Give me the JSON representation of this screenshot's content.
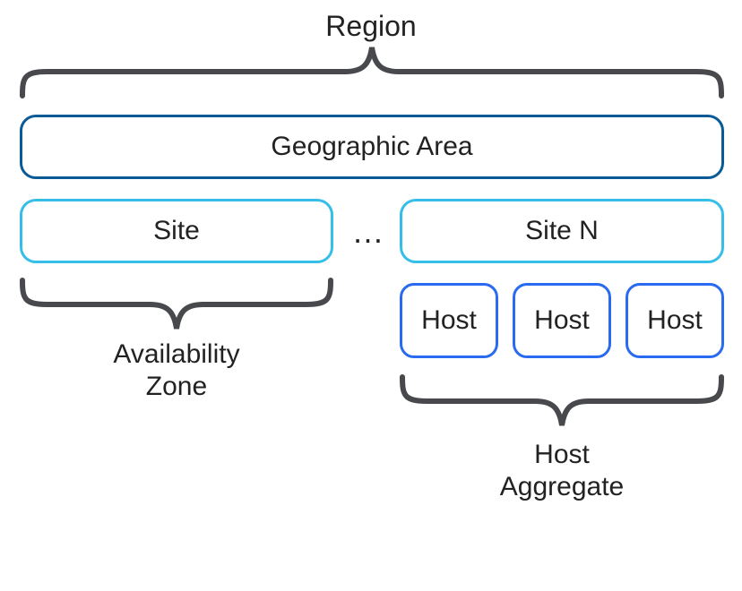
{
  "labels": {
    "region": "Region",
    "geographic_area": "Geographic Area",
    "site": "Site",
    "ellipsis": "…",
    "site_n": "Site N",
    "host1": "Host",
    "host2": "Host",
    "host3": "Host",
    "availability_zone_l1": "Availability",
    "availability_zone_l2": "Zone",
    "host_aggregate_l1": "Host",
    "host_aggregate_l2": "Aggregate"
  }
}
